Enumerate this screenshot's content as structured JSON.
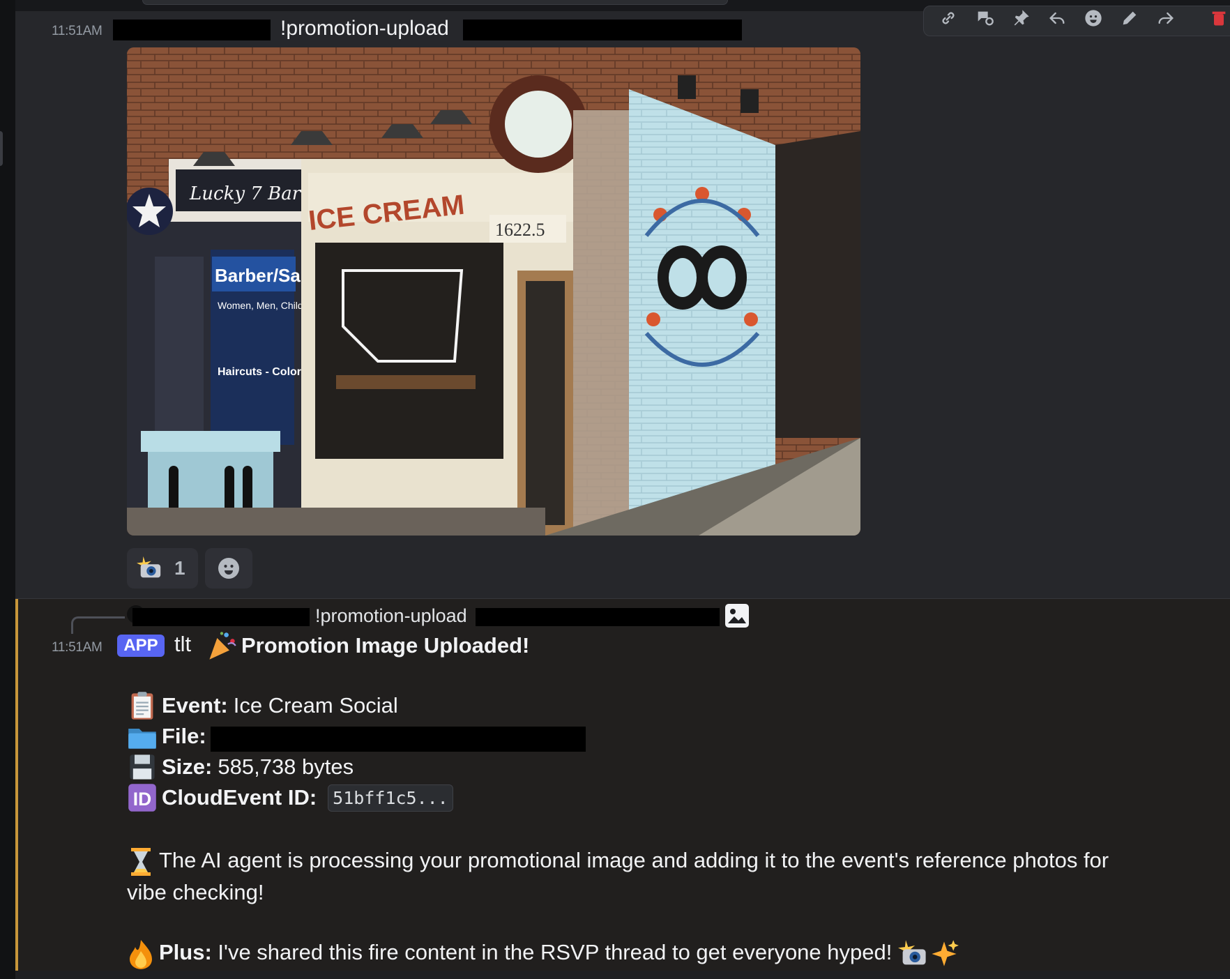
{
  "toolbar": {
    "icons": [
      "link-icon",
      "thread-icon",
      "pin-icon",
      "reply-icon",
      "emoji-icon",
      "edit-icon",
      "forward-icon",
      "delete-icon"
    ]
  },
  "message1": {
    "timestamp": "11:51AM",
    "command": "!promotion-upload",
    "image_alt": "Storefront with ICE CREAM sign, barber salon and mural",
    "image_signs": {
      "ice_cream": "ICE CREAM",
      "barber": "Barber/Salon",
      "barber_sub": "Women, Men, Children",
      "haircuts": "Haircuts - Color - Foils",
      "address": "1622.5"
    },
    "reaction": {
      "emoji": "camera-flash",
      "count": "1"
    }
  },
  "message2": {
    "reply_preview": "!promotion-upload",
    "timestamp": "11:51AM",
    "badge": "APP",
    "username": "tlt",
    "headline": "Promotion Image Uploaded!",
    "event_label": "Event:",
    "event_value": "Ice Cream Social",
    "file_label": "File:",
    "size_label": "Size:",
    "size_value": "585,738 bytes",
    "cloudevent_label": "CloudEvent ID:",
    "cloudevent_value": "51bff1c5...",
    "processing_text": "The AI agent is processing your promotional image and adding it to the event's reference photos for vibe checking!",
    "plus_label": "Plus:",
    "plus_text": "I've shared this fire content in the RSVP thread to get everyone hyped!"
  },
  "colors": {
    "background": "#1e1f22",
    "highlight_bar": "#c8963a",
    "app_badge": "#5865f2",
    "delete": "#da373c"
  }
}
